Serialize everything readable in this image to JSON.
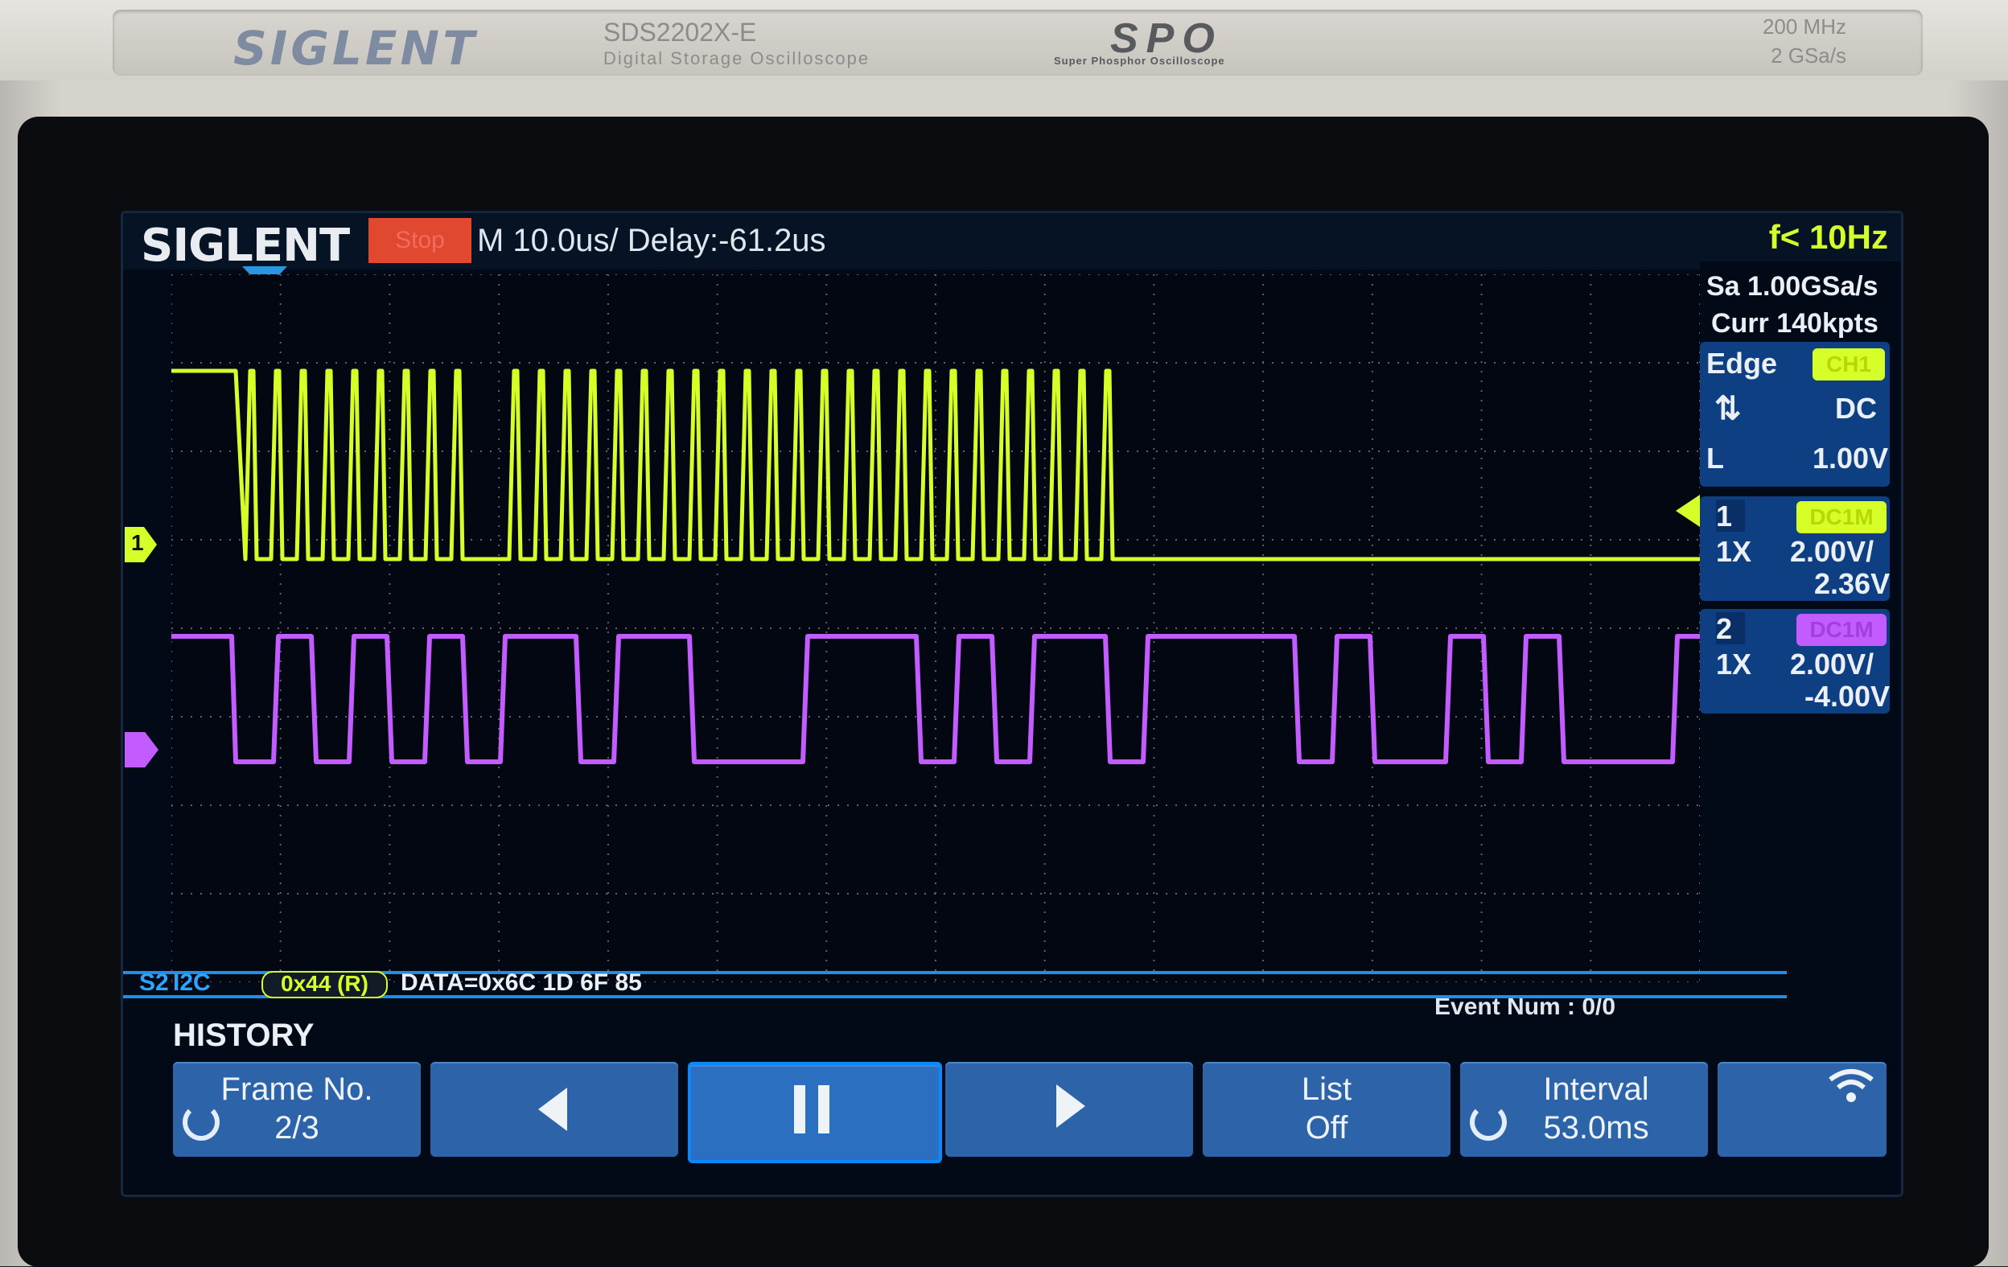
{
  "bezel": {
    "brand": "SIGLENT",
    "model": "SDS2202X-E",
    "description": "Digital Storage Oscilloscope",
    "spo_logo": "SPO",
    "spo_subtitle": "Super Phosphor Oscilloscope",
    "spec_bandwidth": "200 MHz",
    "spec_samplerate": "2 GSa/s"
  },
  "screen": {
    "logo": "SIGLENT",
    "run_state": "Stop",
    "timebase": "M 10.0us/ Delay:-61.2us",
    "trigger_freq": "f< 10Hz",
    "sample_rate": "Sa 1.00GSa/s",
    "memory_depth": "Curr 140kpts",
    "trigger": {
      "type": "Edge",
      "source": "CH1",
      "slope_icon": "edge-both-icon",
      "coupling": "DC",
      "level_label": "L",
      "level": "1.00V"
    },
    "channels": [
      {
        "num": "1",
        "coupling": "DC1M",
        "probe": "1X",
        "scale": "2.00V/",
        "offset": "2.36V",
        "color": "#d6ff2a"
      },
      {
        "num": "2",
        "coupling": "DC1M",
        "probe": "1X",
        "scale": "2.00V/",
        "offset": "-4.00V",
        "color": "#c35cff"
      }
    ],
    "ch1_marker": "1",
    "decode": {
      "label": "S2",
      "protocol": "I2C",
      "address": "0x44 (R)",
      "data": "DATA=0x6C 1D 6F 85"
    },
    "event_num": "Event Num : 0/0",
    "history": {
      "title": "HISTORY",
      "frame_label": "Frame No.",
      "frame_value": "2/3",
      "list_label": "List",
      "list_value": "Off",
      "interval_label": "Interval",
      "interval_value": "53.0ms"
    }
  },
  "colors": {
    "ch1": "#d6ff2a",
    "ch2": "#c35cff",
    "accent": "#2a97e3",
    "softkey": "#2d63a8",
    "stop": "#e0482f"
  }
}
